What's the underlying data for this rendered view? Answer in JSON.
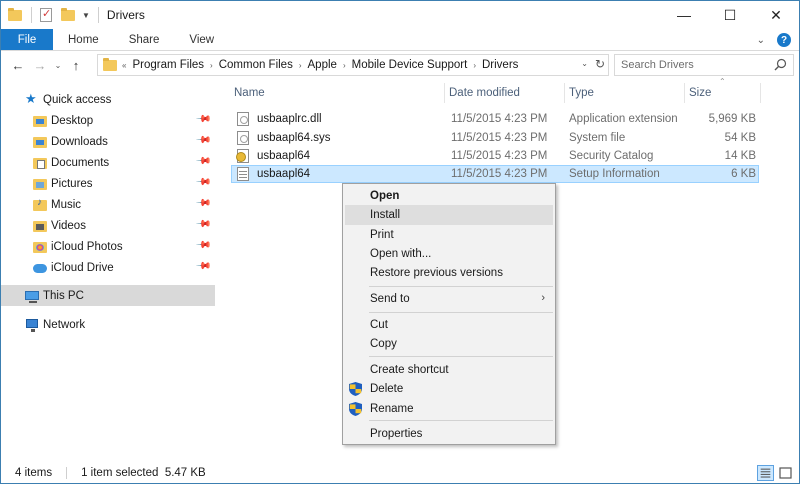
{
  "window": {
    "title": "Drivers",
    "controls": {
      "minimize": "—",
      "maximize": "☐",
      "close": "✕"
    }
  },
  "ribbon": {
    "tabs": [
      "File",
      "Home",
      "Share",
      "View"
    ],
    "expand_chevron": "⌄",
    "help": "?"
  },
  "nav": {
    "back": "←",
    "forward": "→",
    "recent": "⌄",
    "up": "↑",
    "breadcrumb": [
      "Program Files",
      "Common Files",
      "Apple",
      "Mobile Device Support",
      "Drivers"
    ],
    "breadcrumb_sep": "›",
    "lead_sep": "«",
    "dropdown": "⌄",
    "refresh": "↻",
    "search_placeholder": "Search Drivers"
  },
  "navpane": {
    "items": [
      {
        "label": "Quick access",
        "icon": "star-icon",
        "pinned": false
      },
      {
        "label": "Desktop",
        "icon": "desktop-folder-icon",
        "pinned": true
      },
      {
        "label": "Downloads",
        "icon": "downloads-folder-icon",
        "pinned": true
      },
      {
        "label": "Documents",
        "icon": "documents-folder-icon",
        "pinned": true
      },
      {
        "label": "Pictures",
        "icon": "pictures-folder-icon",
        "pinned": true
      },
      {
        "label": "Music",
        "icon": "music-folder-icon",
        "pinned": true
      },
      {
        "label": "Videos",
        "icon": "videos-folder-icon",
        "pinned": true
      },
      {
        "label": "iCloud Photos",
        "icon": "icloud-photos-icon",
        "pinned": true
      },
      {
        "label": "iCloud Drive",
        "icon": "icloud-drive-icon",
        "pinned": true
      },
      {
        "label": "This PC",
        "icon": "this-pc-icon",
        "pinned": false
      },
      {
        "label": "Network",
        "icon": "network-icon",
        "pinned": false
      }
    ],
    "pin_glyph": "📌"
  },
  "filelist": {
    "columns": [
      "Name",
      "Date modified",
      "Type",
      "Size"
    ],
    "sort_indicator": "⌃",
    "rows": [
      {
        "name": "usbaaplrc.dll",
        "date": "11/5/2015 4:23 PM",
        "type": "Application extension",
        "size": "5,969 KB",
        "icon": "dll-file-icon"
      },
      {
        "name": "usbaapl64.sys",
        "date": "11/5/2015 4:23 PM",
        "type": "System file",
        "size": "54 KB",
        "icon": "sys-file-icon"
      },
      {
        "name": "usbaapl64",
        "date": "11/5/2015 4:23 PM",
        "type": "Security Catalog",
        "size": "14 KB",
        "icon": "security-catalog-icon"
      },
      {
        "name": "usbaapl64",
        "date": "11/5/2015 4:23 PM",
        "type": "Setup Information",
        "size": "6 KB",
        "icon": "setup-information-icon"
      }
    ]
  },
  "context_menu": {
    "items": [
      {
        "label": "Open"
      },
      {
        "label": "Install"
      },
      {
        "label": "Print"
      },
      {
        "label": "Open with..."
      },
      {
        "label": "Restore previous versions"
      },
      {
        "label": "Send to"
      },
      {
        "label": "Cut"
      },
      {
        "label": "Copy"
      },
      {
        "label": "Create shortcut"
      },
      {
        "label": "Delete"
      },
      {
        "label": "Rename"
      },
      {
        "label": "Properties"
      }
    ],
    "submenu_arrow": "›"
  },
  "status": {
    "item_count": "4 items",
    "selection": "1 item selected  5.47 KB"
  },
  "colors": {
    "accent": "#1979ca",
    "selection_bg": "#cce8ff",
    "selection_border": "#99d1ff",
    "nav_selected_bg": "#d9d9d9",
    "menu_bg": "#f2f2f2",
    "menu_hover": "#dedede"
  }
}
